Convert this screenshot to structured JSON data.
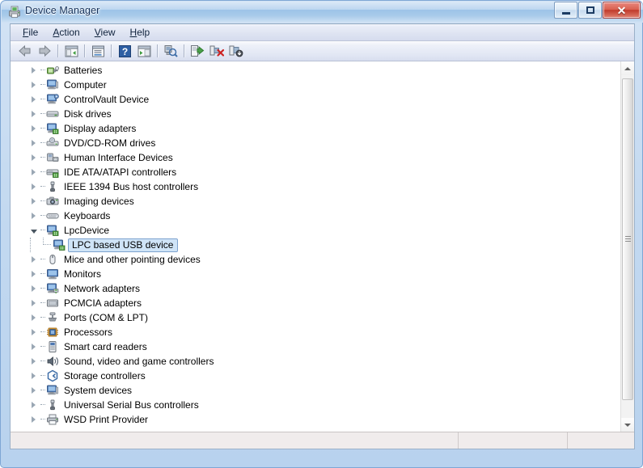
{
  "window": {
    "title": "Device Manager",
    "icon": "device-manager-icon",
    "controls": {
      "minimize": "Minimize",
      "maximize": "Maximize",
      "close": "Close"
    }
  },
  "menubar": {
    "items": [
      {
        "label": "File",
        "accel": "F"
      },
      {
        "label": "Action",
        "accel": "A"
      },
      {
        "label": "View",
        "accel": "V"
      },
      {
        "label": "Help",
        "accel": "H"
      }
    ]
  },
  "toolbar": {
    "buttons": [
      {
        "name": "back-arrow-icon",
        "tip": "Back"
      },
      {
        "name": "forward-arrow-icon",
        "tip": "Forward"
      },
      {
        "name": "show-hide-console-tree-icon",
        "tip": "Show/Hide Console Tree"
      },
      {
        "name": "properties-icon",
        "tip": "Properties"
      },
      {
        "name": "help-icon",
        "tip": "Help"
      },
      {
        "name": "show-hide-action-pane-icon",
        "tip": "Show/Hide Action Pane"
      },
      {
        "name": "scan-for-hardware-changes-icon",
        "tip": "Scan for hardware changes"
      },
      {
        "name": "update-driver-icon",
        "tip": "Update Driver Software"
      },
      {
        "name": "uninstall-device-icon",
        "tip": "Uninstall"
      },
      {
        "name": "disable-device-icon",
        "tip": "Disable"
      }
    ]
  },
  "tree": {
    "rows": [
      {
        "label": "Batteries",
        "level": 1,
        "state": "collapsed",
        "icon": "battery-icon"
      },
      {
        "label": "Computer",
        "level": 1,
        "state": "collapsed",
        "icon": "computer-icon"
      },
      {
        "label": "ControlVault Device",
        "level": 1,
        "state": "collapsed",
        "icon": "controlvault-icon"
      },
      {
        "label": "Disk drives",
        "level": 1,
        "state": "collapsed",
        "icon": "disk-drive-icon"
      },
      {
        "label": "Display adapters",
        "level": 1,
        "state": "collapsed",
        "icon": "display-adapter-icon"
      },
      {
        "label": "DVD/CD-ROM drives",
        "level": 1,
        "state": "collapsed",
        "icon": "dvd-drive-icon"
      },
      {
        "label": "Human Interface Devices",
        "level": 1,
        "state": "collapsed",
        "icon": "hid-icon"
      },
      {
        "label": "IDE ATA/ATAPI controllers",
        "level": 1,
        "state": "collapsed",
        "icon": "ide-controller-icon"
      },
      {
        "label": "IEEE 1394 Bus host controllers",
        "level": 1,
        "state": "collapsed",
        "icon": "ieee1394-icon"
      },
      {
        "label": "Imaging devices",
        "level": 1,
        "state": "collapsed",
        "icon": "camera-icon"
      },
      {
        "label": "Keyboards",
        "level": 1,
        "state": "collapsed",
        "icon": "keyboard-icon"
      },
      {
        "label": "LpcDevice",
        "level": 1,
        "state": "expanded",
        "icon": "lpc-device-icon"
      },
      {
        "label": "LPC based USB device",
        "level": 2,
        "state": "leaf",
        "icon": "lpc-usb-device-icon",
        "selected": true
      },
      {
        "label": "Mice and other pointing devices",
        "level": 1,
        "state": "collapsed",
        "icon": "mouse-icon"
      },
      {
        "label": "Monitors",
        "level": 1,
        "state": "collapsed",
        "icon": "monitor-icon"
      },
      {
        "label": "Network adapters",
        "level": 1,
        "state": "collapsed",
        "icon": "network-adapter-icon"
      },
      {
        "label": "PCMCIA adapters",
        "level": 1,
        "state": "collapsed",
        "icon": "pcmcia-icon"
      },
      {
        "label": "Ports (COM & LPT)",
        "level": 1,
        "state": "collapsed",
        "icon": "port-icon"
      },
      {
        "label": "Processors",
        "level": 1,
        "state": "collapsed",
        "icon": "processor-icon"
      },
      {
        "label": "Smart card readers",
        "level": 1,
        "state": "collapsed",
        "icon": "smartcard-reader-icon"
      },
      {
        "label": "Sound, video and game controllers",
        "level": 1,
        "state": "collapsed",
        "icon": "sound-icon"
      },
      {
        "label": "Storage controllers",
        "level": 1,
        "state": "collapsed",
        "icon": "storage-controller-icon"
      },
      {
        "label": "System devices",
        "level": 1,
        "state": "collapsed",
        "icon": "system-device-icon"
      },
      {
        "label": "Universal Serial Bus controllers",
        "level": 1,
        "state": "collapsed",
        "icon": "usb-controller-icon"
      },
      {
        "label": "WSD Print Provider",
        "level": 1,
        "state": "collapsed",
        "icon": "printer-icon"
      }
    ]
  },
  "statusbar": {
    "pane1": "",
    "pane2": "",
    "pane3": ""
  },
  "scrollbar": {
    "up_arrow": "scroll-up-icon",
    "down_arrow": "scroll-down-icon",
    "thumb": "scroll-thumb"
  },
  "colors": {
    "selection_fill": "#cfe4f7",
    "selection_border": "#7da2ce",
    "titlebar_text": "#15325b",
    "close_button": "#c03a2b",
    "menubar_bg": "#dfe4f2",
    "statusbar_bg": "#f0ecec"
  }
}
